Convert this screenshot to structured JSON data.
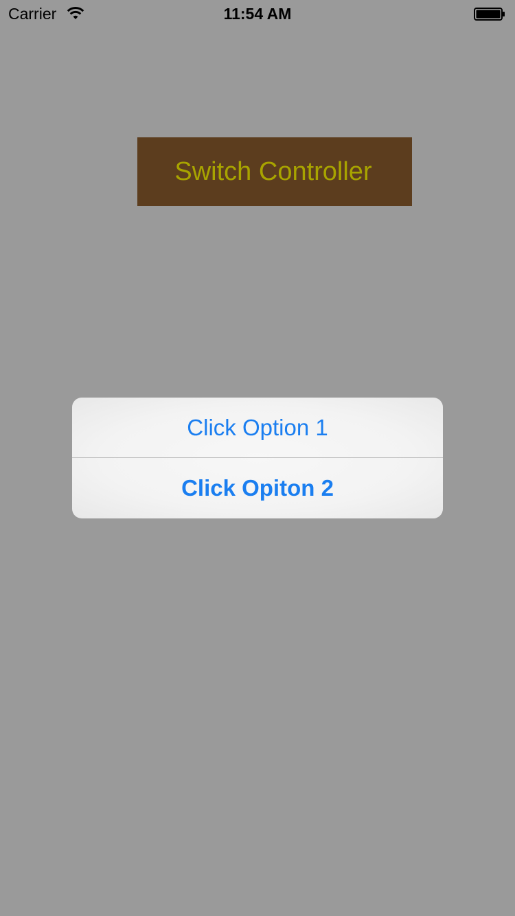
{
  "status_bar": {
    "carrier": "Carrier",
    "time": "11:54 AM",
    "wifi_icon": "wifi-icon",
    "battery_icon": "battery-icon"
  },
  "main": {
    "switch_button_label": "Switch Controller",
    "switch_button_bg": "#5c3d1e",
    "switch_button_fg": "#a8a400"
  },
  "alert": {
    "options": [
      {
        "label": "Click Option 1"
      },
      {
        "label": "Click Opiton 2"
      }
    ],
    "action_color": "#1a7ef0"
  },
  "colors": {
    "background": "#9a9a9a"
  }
}
